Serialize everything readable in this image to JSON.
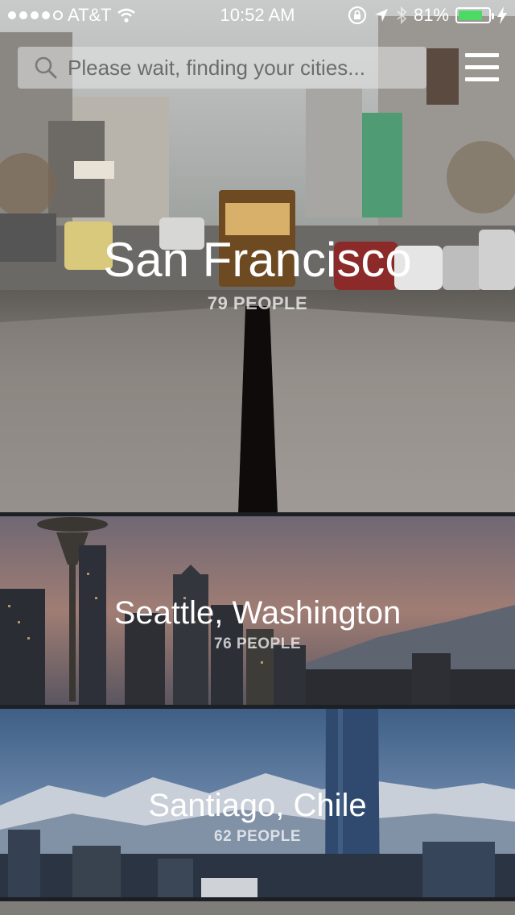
{
  "status_bar": {
    "carrier": "AT&T",
    "time": "10:52 AM",
    "battery_percent": "81%",
    "battery_level": 0.81,
    "signal_bars": 4
  },
  "search": {
    "placeholder": "Please wait, finding your cities..."
  },
  "cities": [
    {
      "name": "San Francisco",
      "people": "79 PEOPLE"
    },
    {
      "name": "Seattle, Washington",
      "people": "76 PEOPLE"
    },
    {
      "name": "Santiago, Chile",
      "people": "62 PEOPLE"
    }
  ],
  "icons": {
    "search": "search-icon",
    "menu": "hamburger-menu-icon",
    "wifi": "wifi-icon",
    "lock": "orientation-lock-icon",
    "location": "location-arrow-icon",
    "bluetooth": "bluetooth-icon",
    "battery": "battery-icon",
    "charging": "charging-bolt-icon"
  },
  "colors": {
    "battery_fill": "#4cd964"
  }
}
